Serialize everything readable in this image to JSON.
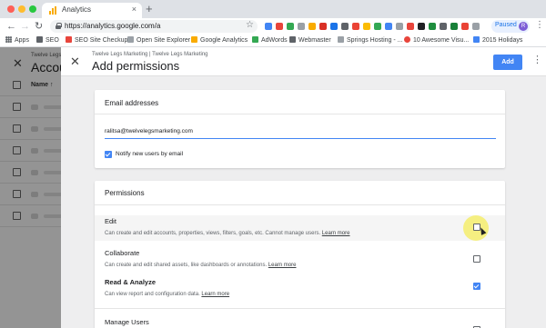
{
  "browser": {
    "tab_title": "Analytics",
    "tab_close": "×",
    "new_tab": "+",
    "url_visible": "https://analytics.google.com/a",
    "paused_label": "Paused",
    "avatar_initial": "R",
    "nav": {
      "back": "←",
      "forward": "→",
      "reload": "↻"
    },
    "star": "☆",
    "menu": "⋮"
  },
  "bookmarks": [
    {
      "label": "Apps",
      "icon": "apps-grid-icon",
      "color": "#5f6368"
    },
    {
      "label": "SEO",
      "icon": "folder-icon",
      "color": "#5f6368"
    },
    {
      "label": "SEO Site Checkup",
      "icon": "seo-site-checkup-icon",
      "color": "#e8453c"
    },
    {
      "label": "Open Site Explorer",
      "icon": "page-icon",
      "color": "#9aa0a6"
    },
    {
      "label": "Google Analytics",
      "icon": "analytics-icon",
      "color": "#f9ab00"
    },
    {
      "label": "AdWords",
      "icon": "adwords-icon",
      "color": "#34a853"
    },
    {
      "label": "Webmaster",
      "icon": "webmaster-icon",
      "color": "#5f6368"
    },
    {
      "label": "Springs Hosting - ...",
      "icon": "page-icon",
      "color": "#9aa0a6"
    },
    {
      "label": "10 Awesome Visu...",
      "icon": "circle-icon",
      "color": "#e8453c"
    },
    {
      "label": "2015 Holidays",
      "icon": "holiday-icon",
      "color": "#4285f4"
    }
  ],
  "background_page": {
    "close": "✕",
    "subtitle": "Twelve Legs",
    "title": "Accou",
    "column_name": "Name ↑"
  },
  "dialog": {
    "close": "✕",
    "breadcrumb": "Twelve Legs Marketing | Twelve Legs Marketing",
    "title": "Add permissions",
    "add_label": "Add",
    "more": "⋮",
    "email_card": {
      "title": "Email addresses",
      "email_value": "ralitsa@twelvelegsmarketing.com",
      "notify_label": "Notify new users by email",
      "notify_checked": true
    },
    "permissions_card": {
      "title": "Permissions",
      "items": [
        {
          "name": "Edit",
          "desc": "Can create and edit accounts, properties, views, filters, goals, etc. Cannot manage users.",
          "link": "Learn more",
          "checked": false,
          "bold": false
        },
        {
          "name": "Collaborate",
          "desc": "Can create and edit shared assets, like dashboards or annotations.",
          "link": "Learn more",
          "checked": false,
          "bold": false
        },
        {
          "name": "Read & Analyze",
          "desc": "Can view report and configuration data.",
          "link": "Learn more",
          "checked": true,
          "bold": true
        },
        {
          "name": "Manage Users",
          "desc": "",
          "link": "",
          "checked": false,
          "bold": false
        }
      ]
    }
  },
  "colors": {
    "accent": "#4285f4",
    "highlight": "#f5ee64"
  }
}
